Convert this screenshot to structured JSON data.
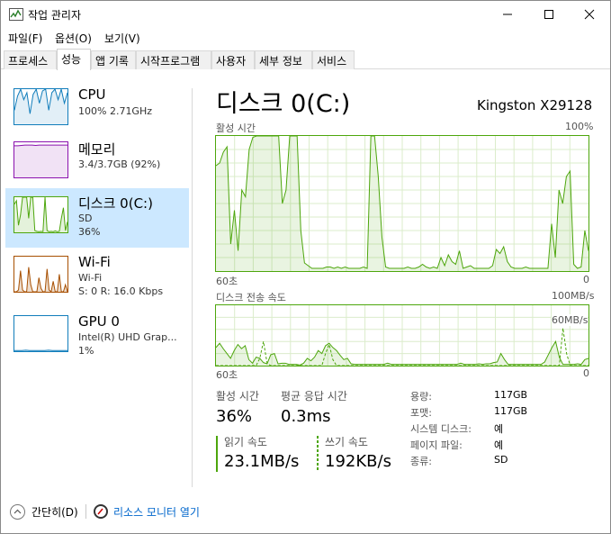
{
  "window": {
    "title": "작업 관리자"
  },
  "menu": [
    "파일(F)",
    "옵션(O)",
    "보기(V)"
  ],
  "tabs": [
    "프로세스",
    "성능",
    "앱 기록",
    "시작프로그램",
    "사용자",
    "세부 정보",
    "서비스"
  ],
  "active_tab": "성능",
  "sidebar": {
    "items": [
      {
        "title": "CPU",
        "sub1": "100%  2.71GHz",
        "sub2": "",
        "color": "#117dbb"
      },
      {
        "title": "메모리",
        "sub1": "3.4/3.7GB (92%)",
        "sub2": "",
        "color": "#8b12ae"
      },
      {
        "title": "디스크 0(C:)",
        "sub1": "SD",
        "sub2": "36%",
        "color": "#4da60c",
        "selected": true
      },
      {
        "title": "Wi-Fi",
        "sub1": "Wi-Fi",
        "sub2": "S: 0  R: 16.0 Kbps",
        "color": "#a74f01"
      },
      {
        "title": "GPU 0",
        "sub1": "Intel(R) UHD Grap...",
        "sub2": "1%",
        "color": "#117dbb"
      }
    ]
  },
  "main": {
    "title": "디스크 0(C:)",
    "model": "Kingston X29128",
    "graph1": {
      "label": "활성 시간",
      "max_label": "100%",
      "x_left": "60초",
      "x_right": "0"
    },
    "graph2": {
      "label": "디스크 전송 속도",
      "max_label": "100MB/s",
      "mid_label": "60MB/s",
      "x_left": "60초",
      "x_right": "0"
    }
  },
  "stats": {
    "active_label": "활성 시간",
    "active_value": "36%",
    "response_label": "평균 응답 시간",
    "response_value": "0.3ms",
    "read_label": "읽기 속도",
    "read_value": "23.1MB/s",
    "write_label": "쓰기 속도",
    "write_value": "192KB/s"
  },
  "properties": [
    {
      "label": "용량:",
      "value": "117GB"
    },
    {
      "label": "포맷:",
      "value": "117GB"
    },
    {
      "label": "시스템 디스크:",
      "value": "예"
    },
    {
      "label": "페이지 파일:",
      "value": "예"
    },
    {
      "label": "종류:",
      "value": "SD"
    }
  ],
  "footer": {
    "collapse_label": "간단히(D)",
    "resmon_label": "리소스 모니터 열기"
  },
  "colors": {
    "disk_green": "#4da60c",
    "selected_bg": "#cce8ff",
    "link_blue": "#0066cc"
  },
  "active_history": [
    78,
    80,
    88,
    92,
    20,
    45,
    15,
    60,
    55,
    90,
    99,
    100,
    100,
    100,
    100,
    100,
    100,
    100,
    50,
    60,
    100,
    100,
    100,
    30,
    6,
    4,
    2,
    2,
    2,
    2,
    3,
    3,
    2,
    3,
    2,
    3,
    2,
    2,
    2,
    2,
    3,
    2,
    100,
    100,
    70,
    25,
    3,
    2,
    2,
    2,
    2,
    2,
    3,
    2,
    2,
    3,
    5,
    3,
    2,
    3,
    2,
    10,
    4,
    12,
    7,
    5,
    15,
    2,
    3,
    4,
    2,
    2,
    2,
    2,
    2,
    4,
    16,
    13,
    18,
    7,
    3,
    2,
    2,
    2,
    3,
    2,
    2,
    2,
    2,
    2,
    2,
    35,
    10,
    60,
    50,
    70,
    74,
    5,
    2,
    3,
    30,
    15
  ],
  "transfer_read": [
    30,
    37,
    28,
    20,
    12,
    25,
    35,
    28,
    33,
    10,
    4,
    14,
    12,
    5,
    3,
    18,
    20,
    3,
    4,
    4,
    2,
    2,
    2,
    1,
    4,
    12,
    8,
    14,
    25,
    20,
    33,
    37,
    30,
    25,
    17,
    10,
    12,
    3,
    2,
    2,
    2,
    2,
    2,
    2,
    2,
    2,
    2,
    4,
    2,
    2,
    2,
    2,
    2,
    2,
    2,
    2,
    2,
    2,
    2,
    2,
    2,
    2,
    2,
    2,
    2,
    2,
    2,
    4,
    2,
    2,
    2,
    2,
    3,
    2,
    3,
    3,
    5,
    6,
    20,
    10,
    2,
    2,
    2,
    2,
    2,
    2,
    2,
    2,
    2,
    2,
    6,
    18,
    30,
    40,
    14,
    2,
    2,
    2,
    2,
    3,
    2,
    10,
    12
  ],
  "transfer_write": [
    0,
    0,
    0,
    0,
    0,
    0,
    0,
    0,
    0,
    0,
    0,
    0,
    12,
    40,
    4,
    0,
    0,
    0,
    0,
    0,
    0,
    0,
    0,
    0,
    0,
    0,
    0,
    0,
    0,
    0,
    20,
    35,
    10,
    0,
    0,
    0,
    0,
    0,
    0,
    0,
    0,
    0,
    0,
    0,
    0,
    0,
    0,
    0,
    0,
    0,
    0,
    0,
    0,
    0,
    0,
    0,
    0,
    0,
    0,
    0,
    0,
    0,
    0,
    0,
    0,
    0,
    0,
    0,
    0,
    0,
    0,
    0,
    0,
    0,
    0,
    0,
    0,
    0,
    0,
    0,
    0,
    0,
    0,
    0,
    0,
    0,
    0,
    0,
    0,
    0,
    0,
    0,
    0,
    0,
    0,
    62,
    20,
    0,
    0,
    0,
    0,
    0,
    0
  ],
  "thumb_cpu": [
    40,
    80,
    100,
    70,
    90,
    30,
    85,
    100,
    60,
    95,
    100,
    40,
    90,
    100,
    70,
    100,
    60,
    90
  ],
  "thumb_mem": [
    90,
    90,
    91,
    92,
    92,
    92,
    91,
    92,
    92,
    92,
    92,
    92,
    92,
    92,
    92,
    92
  ],
  "thumb_disk": [
    80,
    90,
    20,
    50,
    100,
    100,
    100,
    40,
    100,
    100,
    5,
    3,
    2,
    3,
    2,
    100,
    5,
    2,
    3,
    2,
    4,
    2,
    3,
    40,
    70,
    5,
    30
  ],
  "thumb_wifi": [
    0,
    0,
    5,
    60,
    5,
    0,
    0,
    70,
    20,
    0,
    0,
    0,
    40,
    10,
    0,
    0,
    65,
    5,
    0,
    30,
    0,
    0,
    50,
    0,
    0,
    20,
    0
  ],
  "thumb_gpu": [
    2,
    2,
    2,
    3,
    2,
    2,
    2,
    2,
    2,
    3,
    2,
    2,
    2,
    2,
    2
  ]
}
